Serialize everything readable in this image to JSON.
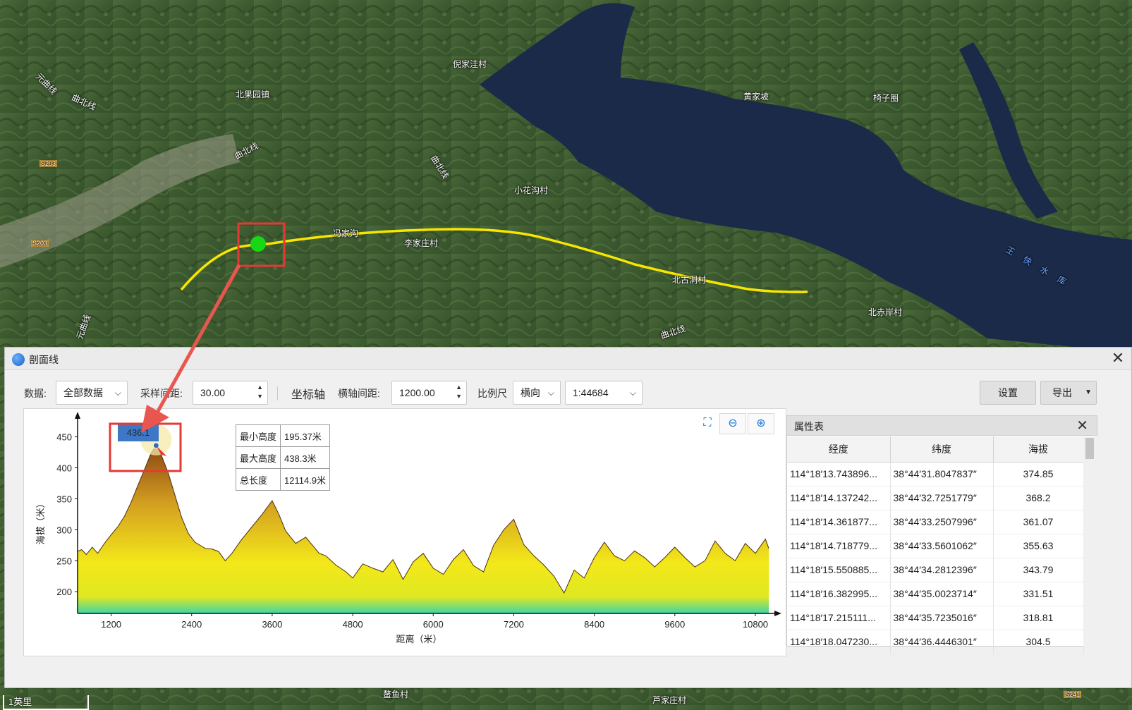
{
  "map": {
    "labels": [
      {
        "text": "倪家洼村"
      },
      {
        "text": "北果园镇"
      },
      {
        "text": "黄家坡"
      },
      {
        "text": "椅子圈"
      },
      {
        "text": "小花沟村"
      },
      {
        "text": "冯家沟"
      },
      {
        "text": "李家庄村"
      },
      {
        "text": "北古洞村"
      },
      {
        "text": "北赤岸村"
      },
      {
        "text": "曲北线"
      },
      {
        "text": "曲北线"
      },
      {
        "text": "曲北线"
      },
      {
        "text": "曲北线"
      },
      {
        "text": "元曲线"
      },
      {
        "text": "元曲线"
      },
      {
        "text": "S203"
      },
      {
        "text": "S203"
      },
      {
        "text": "王快水库"
      },
      {
        "text": "鳌鱼村"
      },
      {
        "text": "芦家庄村"
      },
      {
        "text": "S241"
      }
    ],
    "scale_label": "1英里",
    "colors": {
      "route": "#f7e600",
      "marker": "#16d916",
      "highlight": "#e53935"
    }
  },
  "dialog": {
    "title": "剖面线",
    "toolbar": {
      "data_label": "数据:",
      "data_value": "全部数据",
      "sample_label": "采样间距:",
      "sample_value": "30.00",
      "axis_label": "坐标轴",
      "xinterval_label": "横轴间距:",
      "xinterval_value": "1200.00",
      "scale_label": "比例尺",
      "orientation_value": "横向",
      "scale_value": "1:44684",
      "settings_button": "设置",
      "export_button": "导出"
    },
    "stats": {
      "min_label": "最小高度",
      "min_value": "195.37米",
      "max_label": "最大高度",
      "max_value": "438.3米",
      "len_label": "总长度",
      "len_value": "12114.9米"
    },
    "hover_value": "436.1",
    "attr_table": {
      "title": "属性表",
      "columns": [
        "经度",
        "纬度",
        "海拔"
      ],
      "rows": [
        [
          "114°18′13.743896...",
          "38°44′31.8047837″",
          "374.85"
        ],
        [
          "114°18′14.137242...",
          "38°44′32.7251779″",
          "368.2"
        ],
        [
          "114°18′14.361877...",
          "38°44′33.2507996″",
          "361.07"
        ],
        [
          "114°18′14.718779...",
          "38°44′33.5601062″",
          "355.63"
        ],
        [
          "114°18′15.550885...",
          "38°44′34.2812396″",
          "343.79"
        ],
        [
          "114°18′16.382995...",
          "38°44′35.0023714″",
          "331.51"
        ],
        [
          "114°18′17.215111...",
          "38°44′35.7235016″",
          "318.81"
        ],
        [
          "114°18′18.047230...",
          "38°44′36.4446301″",
          "304.5"
        ]
      ]
    }
  },
  "chart_data": {
    "type": "area",
    "title": "",
    "xlabel": "距离（米）",
    "ylabel": "海拔（米）",
    "xlim": [
      700,
      11000
    ],
    "ylim": [
      165,
      470
    ],
    "xticks": [
      1200,
      2400,
      3600,
      4800,
      6000,
      7200,
      8400,
      9600,
      10800
    ],
    "yticks": [
      200,
      250,
      300,
      350,
      400,
      450
    ],
    "fill_gradient": [
      "#8b4513",
      "#d4a020",
      "#f3e81a",
      "#dfe820",
      "#3fd6a8"
    ],
    "x": [
      700,
      760,
      830,
      920,
      1000,
      1100,
      1200,
      1300,
      1400,
      1500,
      1600,
      1700,
      1800,
      1870,
      1950,
      2050,
      2150,
      2250,
      2350,
      2450,
      2600,
      2700,
      2800,
      2900,
      3000,
      3150,
      3300,
      3450,
      3600,
      3700,
      3800,
      3950,
      4100,
      4200,
      4300,
      4400,
      4550,
      4700,
      4800,
      4950,
      5100,
      5250,
      5400,
      5550,
      5700,
      5850,
      6000,
      6150,
      6300,
      6450,
      6600,
      6750,
      6900,
      7050,
      7200,
      7350,
      7500,
      7650,
      7800,
      7950,
      8100,
      8250,
      8400,
      8550,
      8700,
      8850,
      9000,
      9150,
      9300,
      9450,
      9600,
      9750,
      9900,
      10050,
      10200,
      10350,
      10500,
      10650,
      10800,
      10950,
      11000
    ],
    "y": [
      265,
      268,
      260,
      272,
      262,
      278,
      292,
      305,
      322,
      345,
      372,
      398,
      425,
      436,
      420,
      392,
      356,
      320,
      294,
      280,
      270,
      269,
      265,
      250,
      262,
      285,
      305,
      325,
      347,
      325,
      298,
      278,
      288,
      275,
      262,
      258,
      243,
      232,
      222,
      245,
      238,
      232,
      252,
      220,
      248,
      262,
      238,
      228,
      252,
      268,
      242,
      232,
      275,
      300,
      317,
      276,
      258,
      243,
      225,
      198,
      235,
      222,
      255,
      280,
      258,
      250,
      266,
      255,
      240,
      255,
      272,
      255,
      240,
      250,
      282,
      262,
      250,
      278,
      262,
      285,
      270
    ]
  }
}
